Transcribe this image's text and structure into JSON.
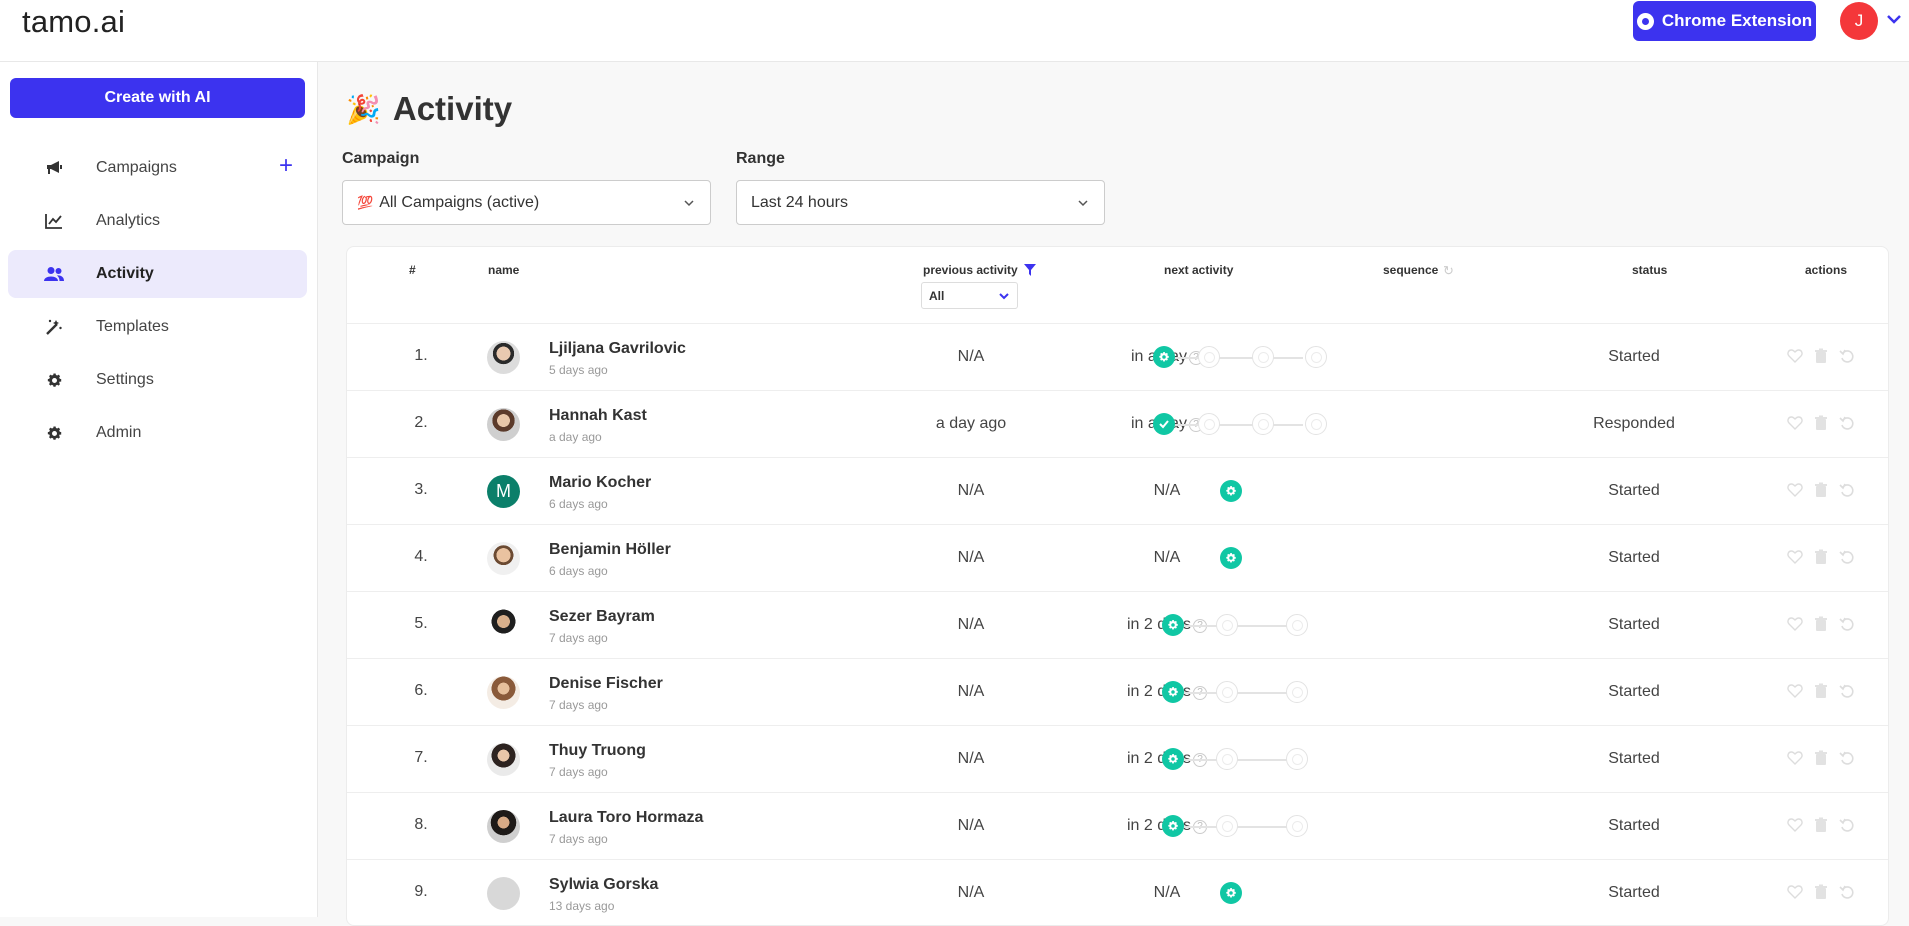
{
  "app": {
    "logo": "tamo.ai"
  },
  "header": {
    "extension_label": "Chrome Extension",
    "user_initial": "J"
  },
  "sidebar": {
    "create_label": "Create with AI",
    "items": [
      {
        "label": "Campaigns",
        "icon": "megaphone-icon"
      },
      {
        "label": "Analytics",
        "icon": "chart-line-icon"
      },
      {
        "label": "Activity",
        "icon": "users-icon",
        "active": true
      },
      {
        "label": "Templates",
        "icon": "magic-wand-icon"
      },
      {
        "label": "Settings",
        "icon": "gear-icon"
      },
      {
        "label": "Admin",
        "icon": "gear-icon"
      }
    ]
  },
  "page": {
    "title": "Activity",
    "title_emoji": "🎉",
    "campaign_label": "Campaign",
    "campaign_emoji": "💯",
    "campaign_value": "All Campaigns (active)",
    "range_label": "Range",
    "range_value": "Last 24 hours"
  },
  "table": {
    "headers": {
      "num": "#",
      "name": "name",
      "prev": "previous activity",
      "next": "next activity",
      "sequence": "sequence",
      "status": "status",
      "actions": "actions"
    },
    "prev_filter": "All",
    "rows": [
      {
        "num": "1.",
        "name": "Ljiljana Gavrilovic",
        "ago": "5 days ago",
        "prev": "N/A",
        "next": "in a day",
        "next_help": true,
        "status": "Started",
        "seq": "4a"
      },
      {
        "num": "2.",
        "name": "Hannah Kast",
        "ago": "a day ago",
        "prev": "a day ago",
        "next": "in a day",
        "next_help": true,
        "status": "Responded",
        "seq": "4b"
      },
      {
        "num": "3.",
        "name": "Mario Kocher",
        "ago": "6 days ago",
        "prev": "N/A",
        "next": "N/A",
        "next_help": false,
        "status": "Started",
        "seq": "1",
        "avatar_initial": "M"
      },
      {
        "num": "4.",
        "name": "Benjamin Höller",
        "ago": "6 days ago",
        "prev": "N/A",
        "next": "N/A",
        "next_help": false,
        "status": "Started",
        "seq": "1"
      },
      {
        "num": "5.",
        "name": "Sezer Bayram",
        "ago": "7 days ago",
        "prev": "N/A",
        "next": "in 2 days",
        "next_help": true,
        "status": "Started",
        "seq": "3"
      },
      {
        "num": "6.",
        "name": "Denise Fischer",
        "ago": "7 days ago",
        "prev": "N/A",
        "next": "in 2 days",
        "next_help": true,
        "status": "Started",
        "seq": "3"
      },
      {
        "num": "7.",
        "name": "Thuy Truong",
        "ago": "7 days ago",
        "prev": "N/A",
        "next": "in 2 days",
        "next_help": true,
        "status": "Started",
        "seq": "3"
      },
      {
        "num": "8.",
        "name": "Laura Toro Hormaza",
        "ago": "7 days ago",
        "prev": "N/A",
        "next": "in 2 days",
        "next_help": true,
        "status": "Started",
        "seq": "3"
      },
      {
        "num": "9.",
        "name": "Sylwia Gorska",
        "ago": "13 days ago",
        "prev": "N/A",
        "next": "N/A",
        "next_help": false,
        "status": "Started",
        "seq": "1"
      }
    ]
  },
  "colors": {
    "accent": "#3c33ef",
    "teal": "#10c7a4",
    "avatar_red": "#f4373a",
    "m_avatar": "#0b7f6a"
  }
}
